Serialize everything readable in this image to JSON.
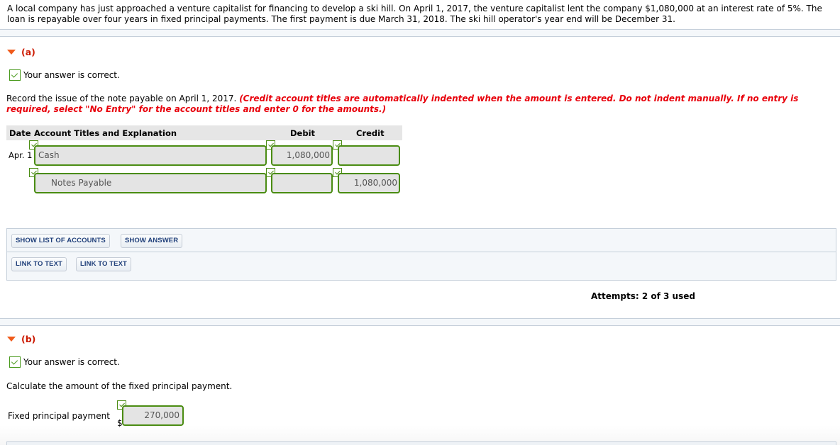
{
  "problem": {
    "text": "A local company has just approached a venture capitalist for financing to develop a ski hill. On April 1, 2017, the venture capitalist lent the company $1,080,000 at an interest rate of 5%. The loan is repayable over four years in fixed principal payments. The first payment is due March 31, 2018. The ski hill operator's year end will be December 31."
  },
  "part_a": {
    "label": "(a)",
    "status": "Your answer is correct.",
    "instruction": "Record the issue of the note payable on April 1, 2017.",
    "instruction_note": "(Credit account titles are automatically indented when the amount is entered. Do not indent manually. If no entry is required, select \"No Entry\" for the account titles and enter 0 for the amounts.)",
    "journal": {
      "headers": {
        "date": "Date",
        "account": "Account Titles and Explanation",
        "debit": "Debit",
        "credit": "Credit"
      },
      "rows": [
        {
          "date": "Apr. 1",
          "account": "Cash",
          "debit": "1,080,000",
          "credit": ""
        },
        {
          "date": "",
          "account": "Notes Payable",
          "debit": "",
          "credit": "1,080,000"
        }
      ]
    },
    "buttons": {
      "show_list": "SHOW LIST OF ACCOUNTS",
      "show_answer": "SHOW ANSWER",
      "link_text_1": "LINK TO TEXT",
      "link_text_2": "LINK TO TEXT"
    },
    "attempts": "Attempts: 2 of 3 used"
  },
  "part_b": {
    "label": "(b)",
    "status": "Your answer is correct.",
    "instruction": "Calculate the amount of the fixed principal payment.",
    "field_label": "Fixed principal payment",
    "currency": "$",
    "value": "270,000"
  },
  "colors": {
    "correct_green": "#4a8c12",
    "part_label_red": "#cc1a00",
    "instruction_red": "#e8000b",
    "button_text_blue": "#1f3f7a",
    "triangle_orange": "#f05a1a"
  }
}
